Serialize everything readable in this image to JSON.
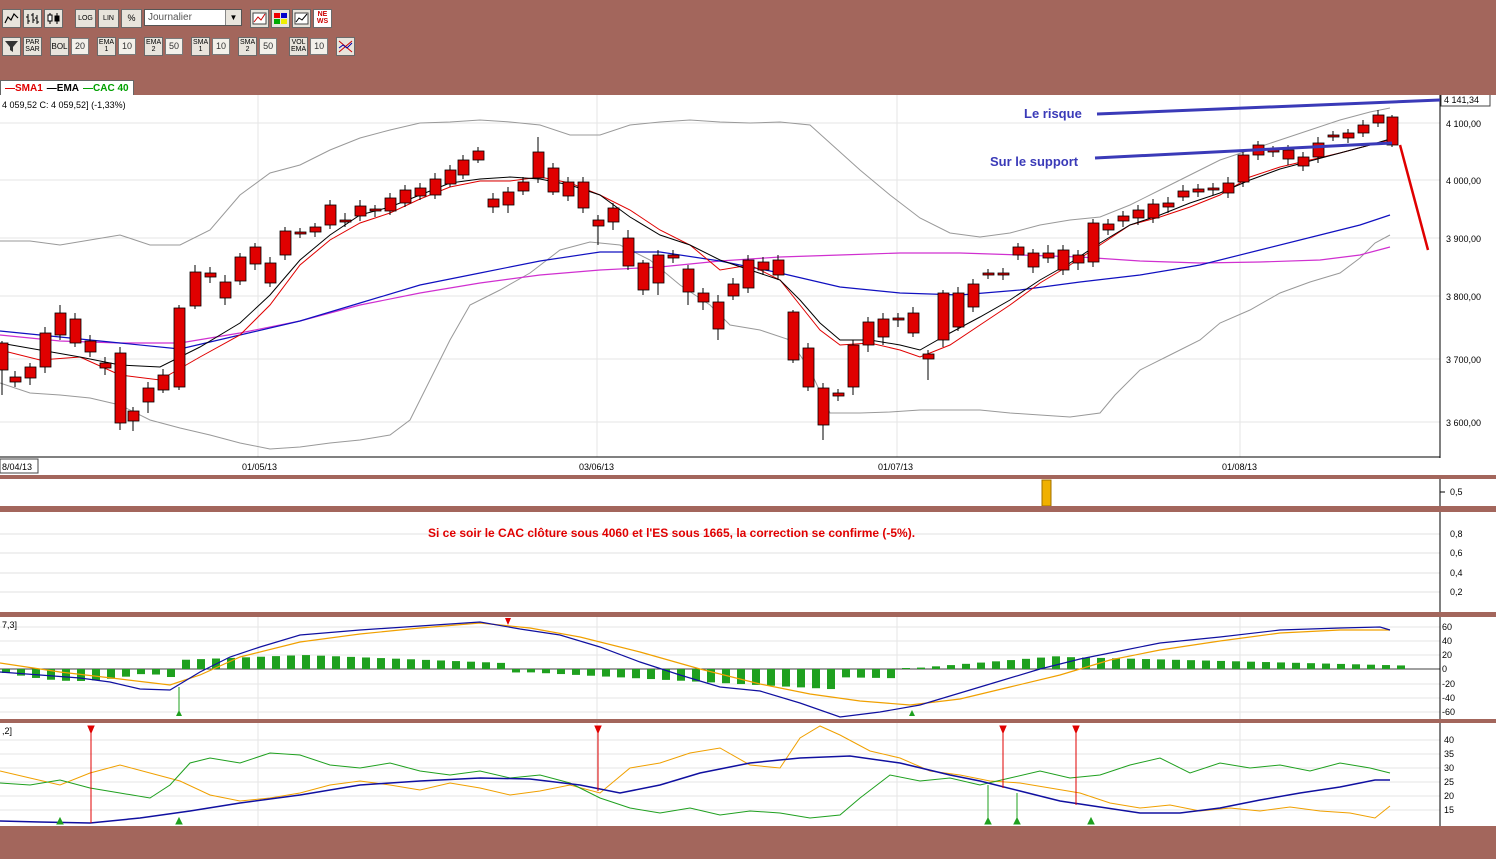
{
  "toolbar1": {
    "buttons": [
      {
        "name": "line-chart-icon"
      },
      {
        "name": "bar-chart-icon"
      },
      {
        "name": "candlestick-chart-icon"
      }
    ],
    "scale_buttons": [
      "LOG",
      "LIN",
      "%"
    ],
    "period_select": "Journalier",
    "right_buttons": [
      {
        "name": "draw-trendline-icon"
      },
      {
        "name": "color-palette-icon"
      },
      {
        "name": "chart-zoom-icon"
      },
      {
        "name": "news-icon",
        "label": "NE\nWS"
      }
    ]
  },
  "toolbar2": {
    "items": [
      {
        "name": "filter-icon",
        "label": ""
      },
      {
        "name": "parabolic-sar-button",
        "label": "PAR\nSAR"
      },
      {
        "name": "bollinger-button",
        "label": "BOL",
        "value": "20"
      },
      {
        "name": "ema1-button",
        "label": "EMA\n1",
        "value": "10"
      },
      {
        "name": "ema2-button",
        "label": "EMA\n2",
        "value": "50"
      },
      {
        "name": "sma1-button",
        "label": "SMA\n1",
        "value": "10"
      },
      {
        "name": "sma2-button",
        "label": "SMA\n2",
        "value": "50"
      },
      {
        "name": "volume-ema-button",
        "label": "VOL\nEMA",
        "value": "10"
      },
      {
        "name": "indicator-settings-icon",
        "label": ""
      }
    ]
  },
  "legend": {
    "items": [
      "SMA1",
      "EMA",
      "CAC 40"
    ],
    "colors": [
      "#e00000",
      "#000000",
      "#00a000"
    ]
  },
  "info": "4 059,52  C: 4 059,52] (-1,33%)",
  "price_tag": "4 141,34",
  "annotations": {
    "risk": "Le risque",
    "support": "Sur le support"
  },
  "comment": "Si ce soir le CAC clôture sous 4060 et l'ES sous 1665, la correction se confirme (-5%).",
  "x_labels": [
    "8/04/13",
    "01/05/13",
    "03/06/13",
    "01/07/13",
    "01/08/13"
  ],
  "price_axis": [
    "4 100,00",
    "4 000,00",
    "3 900,00",
    "3 800,00",
    "3 700,00",
    "3 600,00"
  ],
  "vol_axis": [
    "0,5"
  ],
  "blank_axis": [
    "0,8",
    "0,6",
    "0,4",
    "0,2"
  ],
  "macd_label": "7,3]",
  "macd_axis": [
    "60",
    "40",
    "20",
    "0",
    "-20",
    "-40",
    "-60"
  ],
  "dmi_label": ",2]",
  "dmi_axis": [
    "40",
    "35",
    "30",
    "25",
    "20",
    "15"
  ],
  "colors": {
    "up": "#1fa01f",
    "down": "#e00000",
    "trendline": "#3a3ab8",
    "bollinger": "#888888",
    "sma50": "#d030d0",
    "ema50": "#1010c0"
  }
}
